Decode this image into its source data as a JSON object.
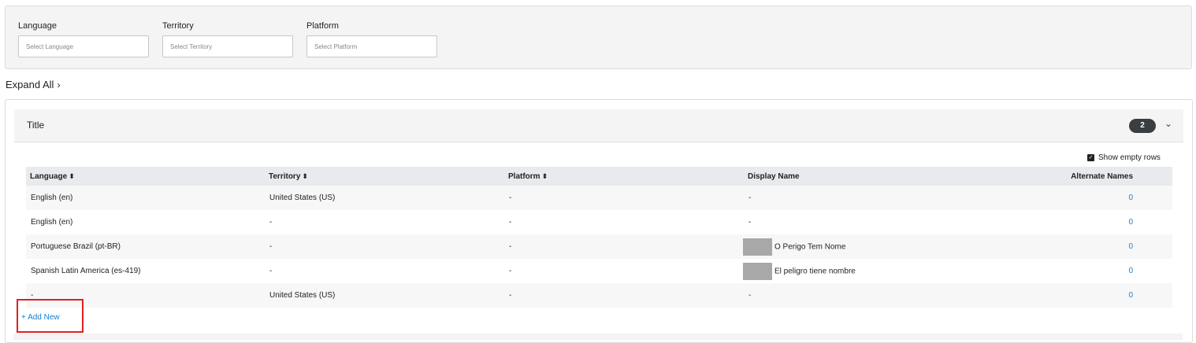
{
  "filters": {
    "language": {
      "label": "Language",
      "placeholder": "Select Language"
    },
    "territory": {
      "label": "Territory",
      "placeholder": "Select Territory"
    },
    "platform": {
      "label": "Platform",
      "placeholder": "Select Platform"
    }
  },
  "expand_all": "Expand All",
  "section": {
    "title": "Title",
    "count": "2",
    "show_empty_rows": "Show empty rows"
  },
  "table": {
    "headers": {
      "language": "Language",
      "territory": "Territory",
      "platform": "Platform",
      "display_name": "Display Name",
      "alternate_names": "Alternate Names"
    },
    "rows": [
      {
        "language": "English (en)",
        "territory": "United States (US)",
        "platform": "-",
        "display_name": "-",
        "alternate_names": "0"
      },
      {
        "language": "English (en)",
        "territory": "-",
        "platform": "-",
        "display_name": "-",
        "alternate_names": "0"
      },
      {
        "language": "Portuguese Brazil (pt-BR)",
        "territory": "-",
        "platform": "-",
        "display_name": "O Perigo Tem Nome",
        "alternate_names": "0"
      },
      {
        "language": "Spanish Latin America (es-419)",
        "territory": "-",
        "platform": "-",
        "display_name": "El peligro tiene nombre",
        "alternate_names": "0"
      },
      {
        "language": "-",
        "territory": "United States (US)",
        "platform": "-",
        "display_name": "-",
        "alternate_names": "0"
      }
    ]
  },
  "add_new": "+ Add New",
  "colors": {
    "link": "#1a7fd0",
    "badge": "#3a3d42",
    "highlight": "#e02020"
  }
}
